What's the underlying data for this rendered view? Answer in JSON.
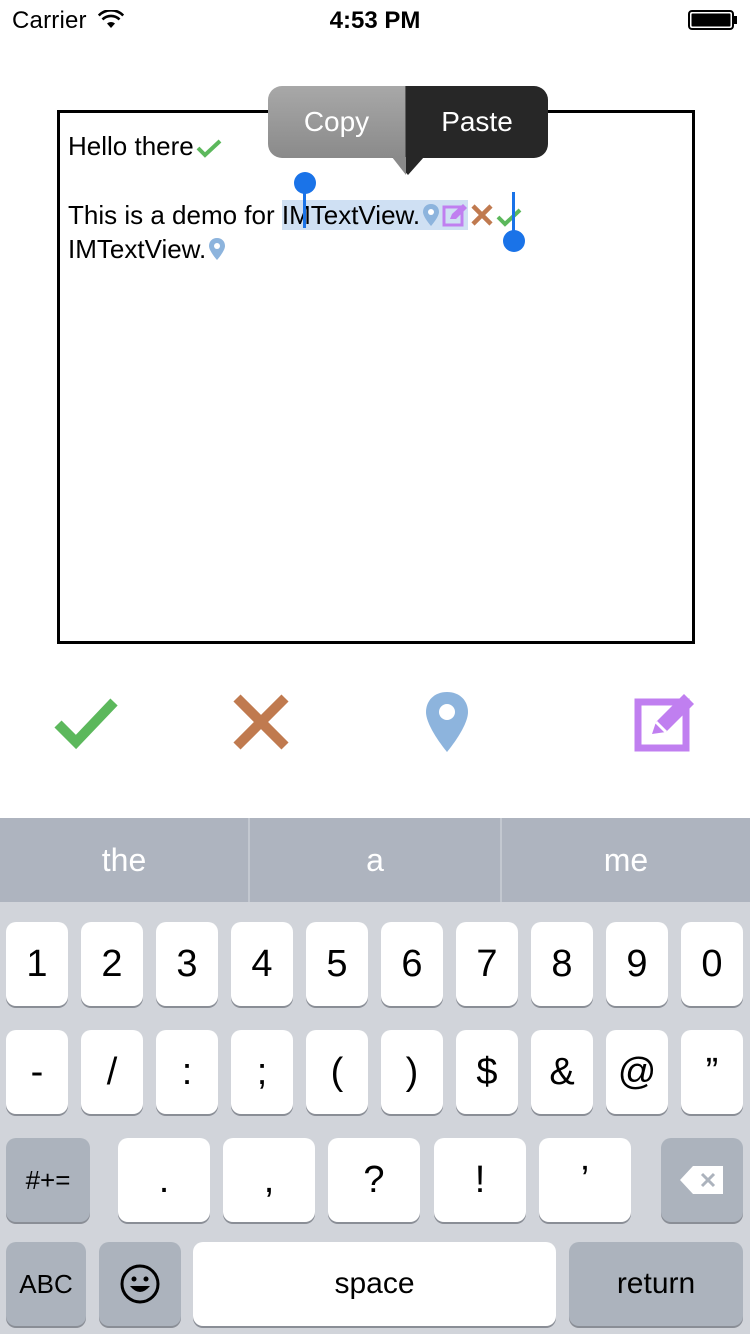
{
  "status_bar": {
    "carrier": "Carrier",
    "time": "4:53 PM"
  },
  "text_view": {
    "line1": "Hello there",
    "line2_prefix": "This is a demo for ",
    "line2_selected": "IMTextView.",
    "line3": "IMTextView."
  },
  "edit_menu": {
    "copy_label": "Copy",
    "paste_label": "Paste"
  },
  "toolbar": {
    "icons": [
      "check-icon",
      "cross-icon",
      "location-pin-icon",
      "edit-icon"
    ]
  },
  "keyboard": {
    "suggestions": [
      "the",
      "a",
      "me"
    ],
    "row1": [
      "1",
      "2",
      "3",
      "4",
      "5",
      "6",
      "7",
      "8",
      "9",
      "0"
    ],
    "row2": [
      "-",
      "/",
      ":",
      ";",
      "(",
      ")",
      "$",
      "&",
      "@",
      "”"
    ],
    "row3_left": "#+=",
    "row3": [
      ".",
      ",",
      "?",
      "!",
      "’"
    ],
    "abc_label": "ABC",
    "space_label": "space",
    "return_label": "return"
  },
  "colors": {
    "check": "#5cb85c",
    "cross": "#c07a4f",
    "pin": "#8db4dd",
    "edit": "#c07ff0",
    "selection": "#cfe0f3",
    "handle": "#1a73e8"
  }
}
